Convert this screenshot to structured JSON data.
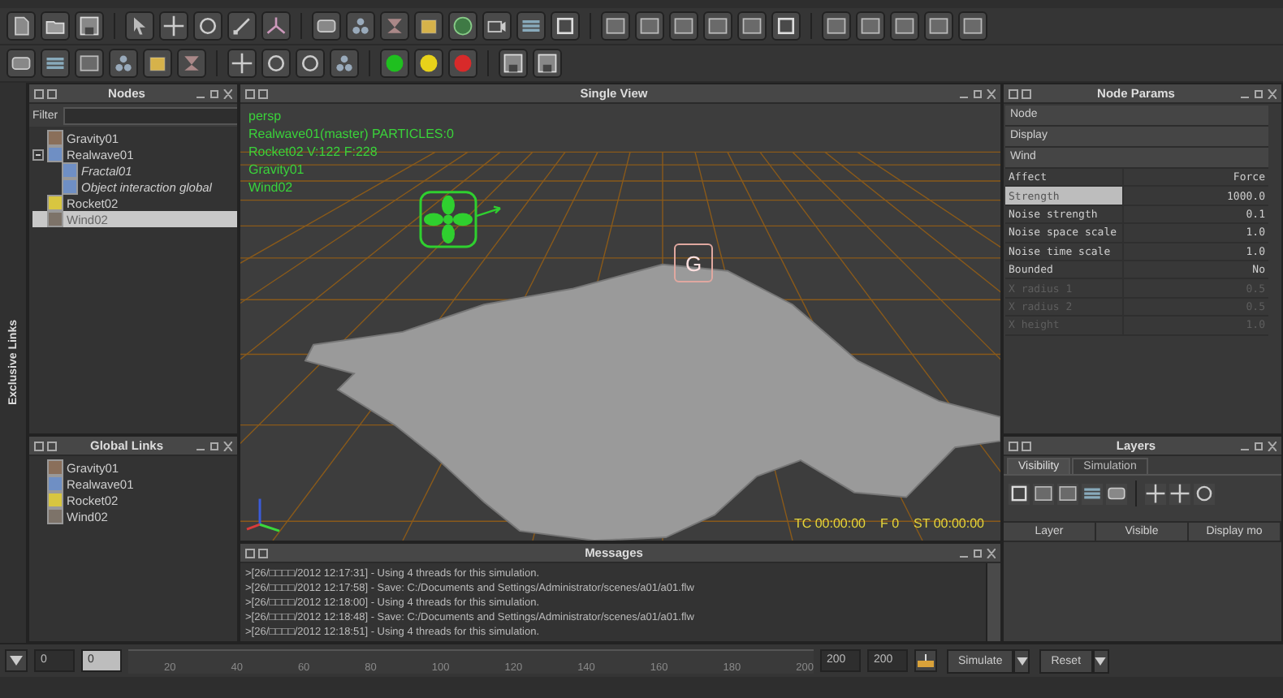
{
  "nodes_panel": {
    "title": "Nodes",
    "filter_label": "Filter",
    "items": [
      {
        "label": "Gravity01",
        "kind": "gravity",
        "selected": false
      },
      {
        "label": "Realwave01",
        "kind": "realwave",
        "selected": false,
        "expanded": true,
        "children": [
          {
            "label": "Fractal01",
            "kind": "realwave",
            "selected": false
          },
          {
            "label": "Object interaction global",
            "kind": "realwave",
            "selected": false
          }
        ]
      },
      {
        "label": "Rocket02",
        "kind": "rocket",
        "selected": false
      },
      {
        "label": "Wind02",
        "kind": "wind",
        "selected": true
      }
    ]
  },
  "side_tab": "Exclusive Links",
  "global_links": {
    "title": "Global Links",
    "items": [
      {
        "label": "Gravity01",
        "kind": "gravity"
      },
      {
        "label": "Realwave01",
        "kind": "realwave"
      },
      {
        "label": "Rocket02",
        "kind": "rocket"
      },
      {
        "label": "Wind02",
        "kind": "wind"
      }
    ]
  },
  "viewport": {
    "title": "Single View",
    "overlay_lines": [
      "persp",
      "Realwave01(master) PARTICLES:0",
      "Rocket02 V:122 F:228",
      "Gravity01",
      "Wind02"
    ],
    "gravity_label": "G",
    "timecode": [
      "TC 00:00:00",
      "F 0",
      "ST 00:00:00"
    ]
  },
  "messages": {
    "title": "Messages",
    "lines": [
      ">[26/□□□□/2012 12:17:31] - Using 4 threads for this simulation.",
      ">[26/□□□□/2012 12:17:58] - Save: C:/Documents and Settings/Administrator/scenes/a01/a01.flw",
      ">[26/□□□□/2012 12:18:00] - Using 4 threads for this simulation.",
      ">[26/□□□□/2012 12:18:48] - Save: C:/Documents and Settings/Administrator/scenes/a01/a01.flw",
      ">[26/□□□□/2012 12:18:51] - Using 4 threads for this simulation."
    ]
  },
  "node_params": {
    "title": "Node Params",
    "sections": [
      "Node",
      "Display",
      "Wind"
    ],
    "params": [
      {
        "name": "Affect",
        "value": "Force",
        "selected": false,
        "disabled": false
      },
      {
        "name": "Strength",
        "value": "1000.0",
        "selected": true,
        "disabled": false
      },
      {
        "name": "Noise strength",
        "value": "0.1",
        "selected": false,
        "disabled": false
      },
      {
        "name": "Noise space scale",
        "value": "1.0",
        "selected": false,
        "disabled": false
      },
      {
        "name": "Noise time scale",
        "value": "1.0",
        "selected": false,
        "disabled": false
      },
      {
        "name": "Bounded",
        "value": "No",
        "selected": false,
        "disabled": false
      },
      {
        "name": "X radius 1",
        "value": "0.5",
        "selected": false,
        "disabled": true
      },
      {
        "name": "X radius 2",
        "value": "0.5",
        "selected": false,
        "disabled": true
      },
      {
        "name": "X height",
        "value": "1.0",
        "selected": false,
        "disabled": true
      }
    ]
  },
  "layers": {
    "title": "Layers",
    "tabs": [
      {
        "label": "Visibility",
        "selected": true
      },
      {
        "label": "Simulation",
        "selected": false
      }
    ],
    "columns": [
      "Layer",
      "Visible",
      "Display mo"
    ]
  },
  "timeline": {
    "start": "0",
    "current": "0",
    "ticks": [
      "20",
      "40",
      "60",
      "80",
      "100",
      "120",
      "140",
      "160",
      "180",
      "200"
    ],
    "end_fields": [
      "200",
      "200"
    ],
    "buttons": [
      "Simulate",
      "Reset"
    ]
  }
}
